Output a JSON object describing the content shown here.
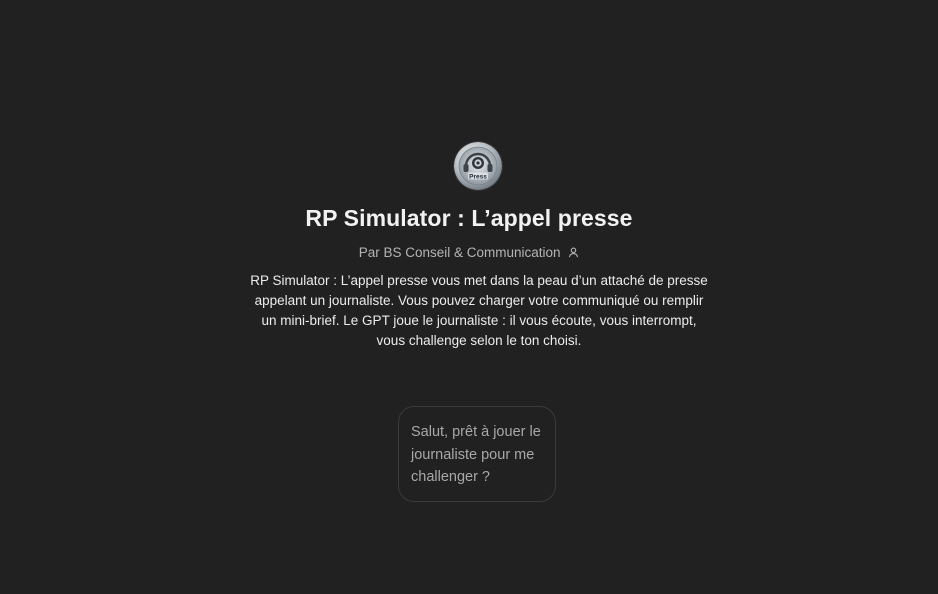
{
  "gpt": {
    "avatar_icon": "press-headset-icon",
    "avatar_label": "Press",
    "title": "RP Simulator : L’appel presse",
    "byline": "Par BS Conseil & Communication",
    "byline_icon": "person-icon",
    "description": "RP Simulator : L’appel presse vous met dans la peau d’un attaché de presse appelant un journaliste. Vous pouvez charger votre communiqué ou remplir un mini-brief. Le GPT joue le journaliste : il vous écoute, vous interrompt, vous challenge selon le ton choisi."
  },
  "conversation_starters": [
    {
      "label": "Salut, prêt à jouer le journaliste pour me challenger ?"
    }
  ],
  "colors": {
    "background": "#212121",
    "text_primary": "#ececec",
    "text_secondary": "#b4b4b4",
    "starter_border": "#3a3a3a"
  }
}
